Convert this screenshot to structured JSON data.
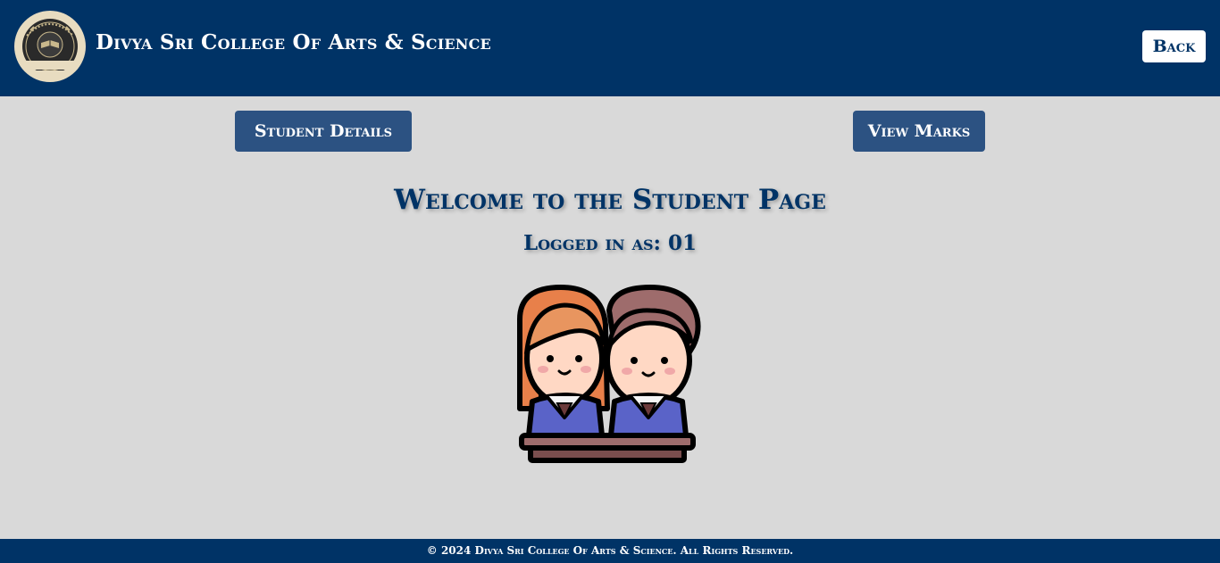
{
  "header": {
    "brand_title": "Divya Sri College Of Arts & Science",
    "logo": {
      "icon": "college-seal-logo",
      "ring_text": "DIVYA SRI COLLEGE",
      "center_text_top": "ARTS & SCIENCE",
      "center_text_bottom": "OF ARTS & SCIENCE"
    },
    "back_label": "Back"
  },
  "nav": {
    "student_details_label": "Student Details",
    "view_marks_label": "View Marks"
  },
  "main": {
    "welcome_heading": "Welcome to the Student Page",
    "logged_in_text": "Logged in as: 01",
    "illustration_icon": "students-at-desk-illustration"
  },
  "footer": {
    "copyright": "© 2024 Divya Sri College Of Arts & Science. All Rights Reserved."
  },
  "colors": {
    "header_bg": "#003366",
    "page_bg": "#d9d9d9",
    "button_bg": "#2c5282",
    "text_primary": "#003366",
    "white": "#ffffff"
  }
}
